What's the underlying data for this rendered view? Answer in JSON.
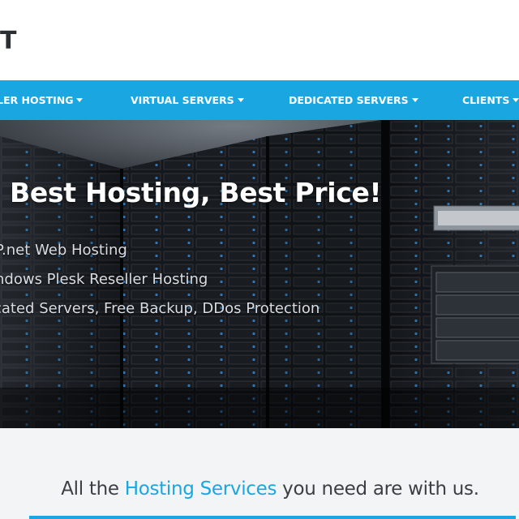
{
  "header": {
    "logo_fragment": "T"
  },
  "nav": {
    "items": [
      {
        "label": "LER HOSTING"
      },
      {
        "label": "VIRTUAL SERVERS"
      },
      {
        "label": "DEDICATED SERVERS"
      },
      {
        "label": "CLIENTS"
      }
    ]
  },
  "hero": {
    "title": "Best Hosting, Best Price!",
    "lines": [
      "P.net Web Hosting",
      "ndows Plesk Reseller Hosting",
      "cated Servers, Free Backup, DDos Protection"
    ]
  },
  "tagline": {
    "before": "All the ",
    "highlight": "Hosting Services",
    "after": " you need are with us."
  },
  "colors": {
    "accent": "#1aa6e0",
    "nav_text": "#ffffff",
    "hero_bg": "#0b0d10",
    "band_bg": "#f3f4f6"
  }
}
